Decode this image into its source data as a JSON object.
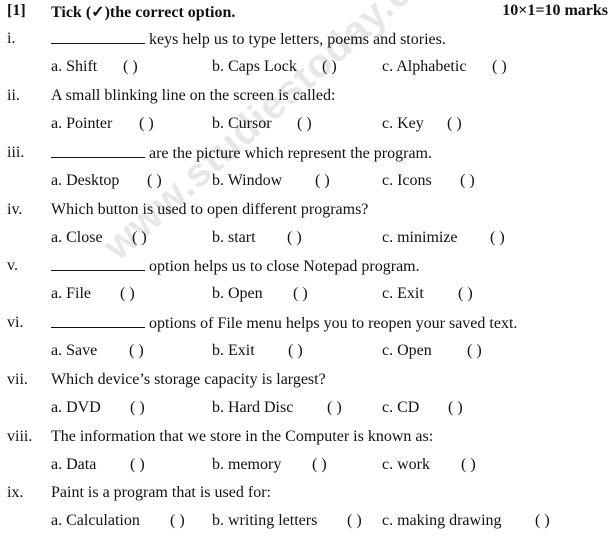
{
  "header": {
    "number": "[1]",
    "title": "Tick (✓)the correct option.",
    "marks": "10×1=10 marks"
  },
  "watermark": "www.studiestoday.com",
  "questions": [
    {
      "num": "i.",
      "has_blank": true,
      "text": "keys help us to type letters, poems and stories.",
      "options": [
        {
          "label": "a. Shift",
          "box": "( )"
        },
        {
          "label": "b. Caps Lock",
          "box": "( )"
        },
        {
          "label": "c. Alphabetic",
          "box": "( )"
        }
      ]
    },
    {
      "num": "ii.",
      "has_blank": false,
      "text": "A small blinking line on the screen is called:",
      "options": [
        {
          "label": "a. Pointer",
          "box": "( )"
        },
        {
          "label": "b. Cursor",
          "box": "( )"
        },
        {
          "label": "c. Key",
          "box": "( )"
        }
      ]
    },
    {
      "num": "iii.",
      "has_blank": true,
      "text": "are the picture which represent the program.",
      "options": [
        {
          "label": "a. Desktop",
          "box": "( )"
        },
        {
          "label": "b. Window",
          "box": "( )"
        },
        {
          "label": "c. Icons",
          "box": "( )"
        }
      ]
    },
    {
      "num": "iv.",
      "has_blank": false,
      "text": "Which button is used to open different programs?",
      "options": [
        {
          "label": "a. Close",
          "box": "( )"
        },
        {
          "label": "b. start",
          "box": "( )"
        },
        {
          "label": "c. minimize",
          "box": "( )"
        }
      ]
    },
    {
      "num": "v.",
      "has_blank": true,
      "text": "option helps us to close Notepad program.",
      "options": [
        {
          "label": "a. File",
          "box": "( )"
        },
        {
          "label": "b. Open",
          "box": "( )"
        },
        {
          "label": "c. Exit",
          "box": "( )"
        }
      ]
    },
    {
      "num": "vi.",
      "has_blank": true,
      "text": "options of File menu helps you to reopen your saved text.",
      "options": [
        {
          "label": "a. Save",
          "box": "( )"
        },
        {
          "label": "b. Exit",
          "box": "( )"
        },
        {
          "label": "c. Open",
          "box": "( )"
        }
      ]
    },
    {
      "num": "vii.",
      "has_blank": false,
      "text": "Which device’s storage capacity is largest?",
      "options": [
        {
          "label": "a. DVD",
          "box": "( )"
        },
        {
          "label": "b. Hard Disc",
          "box": "( )"
        },
        {
          "label": "c. CD",
          "box": "( )"
        }
      ]
    },
    {
      "num": "viii.",
      "has_blank": false,
      "text": "The information that we store in the Computer is known as:",
      "options": [
        {
          "label": "a. Data",
          "box": "( )"
        },
        {
          "label": "b. memory",
          "box": "( )"
        },
        {
          "label": "c. work",
          "box": "( )"
        }
      ]
    },
    {
      "num": "ix.",
      "has_blank": false,
      "text": "Paint is a program that is used for:",
      "options": [
        {
          "label": "a. Calculation",
          "box": "( )"
        },
        {
          "label": "b. writing letters",
          "box": "( )"
        },
        {
          "label": "c. making drawing",
          "box": "( )"
        }
      ]
    }
  ]
}
